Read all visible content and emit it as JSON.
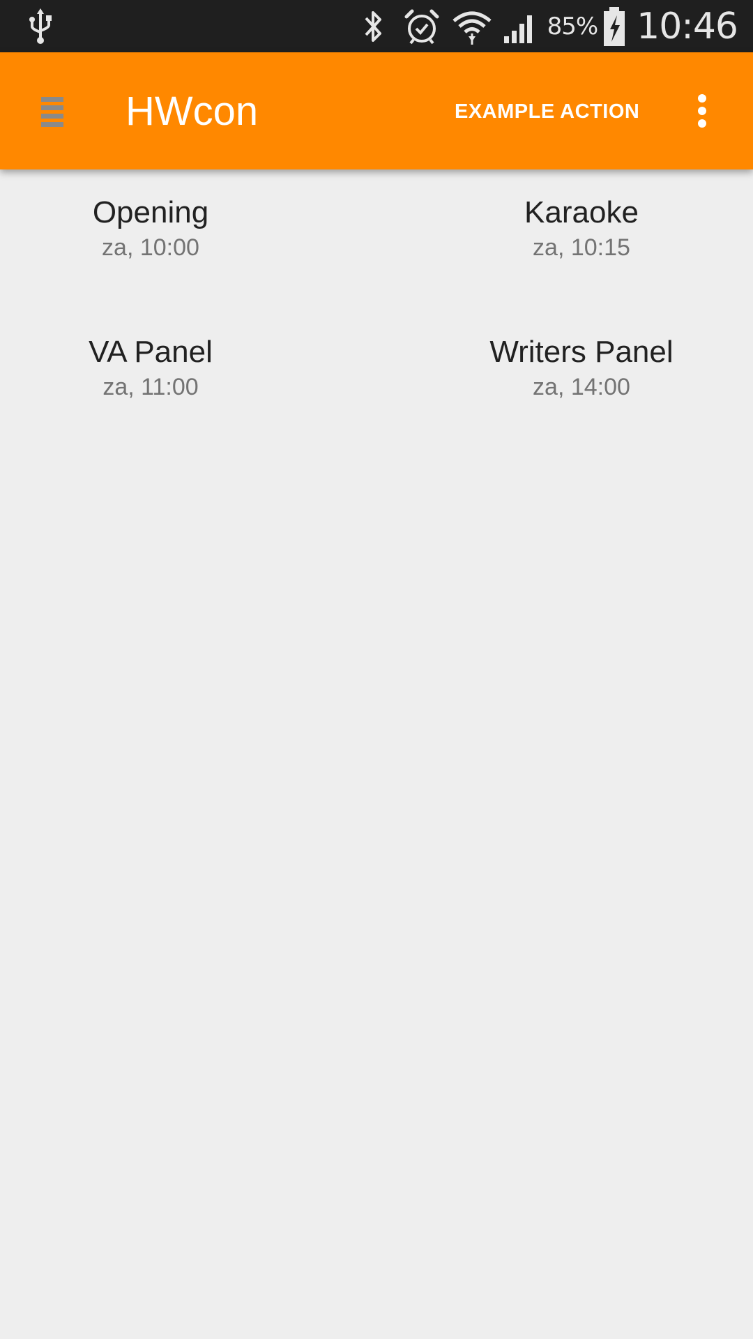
{
  "status_bar": {
    "battery_percent": "85%",
    "time": "10:46",
    "icons": [
      "usb-icon",
      "bluetooth-icon",
      "alarm-icon",
      "wifi-icon",
      "signal-icon",
      "battery-charging-icon"
    ]
  },
  "app_bar": {
    "background_color": "#ff8800",
    "title": "HWcon",
    "action_label": "EXAMPLE ACTION",
    "nav_icon": "drawer-menu-icon",
    "overflow_icon": "overflow-menu-icon"
  },
  "events": [
    {
      "title": "Opening",
      "time": "za, 10:00"
    },
    {
      "title": "Karaoke",
      "time": "za, 10:15"
    },
    {
      "title": "VA Panel",
      "time": "za, 11:00"
    },
    {
      "title": "Writers Panel",
      "time": "za, 14:00"
    }
  ]
}
